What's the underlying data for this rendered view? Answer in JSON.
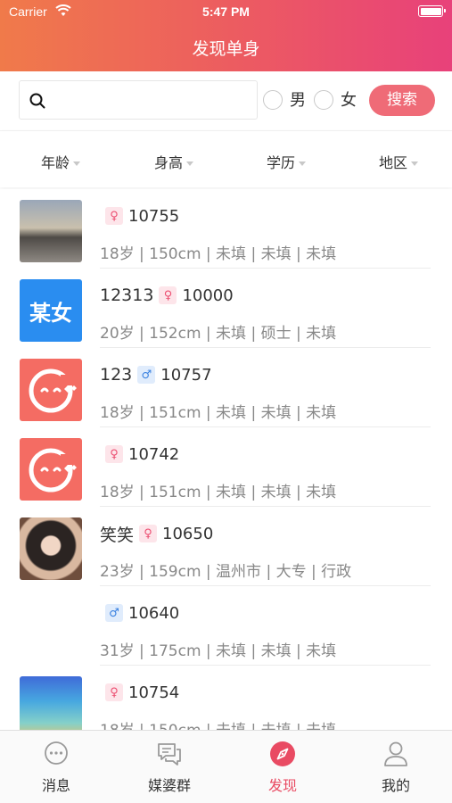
{
  "status_bar": {
    "carrier": "Carrier",
    "time": "5:47 PM"
  },
  "header": {
    "title": "发现单身"
  },
  "search": {
    "placeholder": "",
    "value": "",
    "gender_options": [
      "男",
      "女"
    ],
    "button_label": "搜索"
  },
  "filters": [
    {
      "label": "年龄"
    },
    {
      "label": "身高"
    },
    {
      "label": "学历"
    },
    {
      "label": "地区"
    }
  ],
  "users": [
    {
      "nickname": "",
      "gender": "female",
      "gender_symbol": "♀",
      "id": "10755",
      "details": "18岁 | 150cm | 未填 | 未填 | 未填",
      "avatar_type": "photo-laptop",
      "avatar_text": ""
    },
    {
      "nickname": "12313",
      "gender": "female",
      "gender_symbol": "♀",
      "id": "10000",
      "details": "20岁 | 152cm | 未填 | 硕士 | 未填",
      "avatar_type": "text",
      "avatar_text": "某女"
    },
    {
      "nickname": "123",
      "gender": "male",
      "gender_symbol": "♂",
      "id": "10757",
      "details": "18岁 | 151cm | 未填 | 未填 | 未填",
      "avatar_type": "face",
      "avatar_text": ""
    },
    {
      "nickname": "",
      "gender": "female",
      "gender_symbol": "♀",
      "id": "10742",
      "details": "18岁 | 151cm | 未填 | 未填 | 未填",
      "avatar_type": "face",
      "avatar_text": ""
    },
    {
      "nickname": "笑笑",
      "gender": "female",
      "gender_symbol": "♀",
      "id": "10650",
      "details": "23岁 | 159cm | 温州市 | 大专 | 行政",
      "avatar_type": "photo-girl",
      "avatar_text": ""
    },
    {
      "nickname": "",
      "gender": "male",
      "gender_symbol": "♂",
      "id": "10640",
      "details": "31岁 | 175cm | 未填 | 未填 | 未填",
      "avatar_type": "none",
      "avatar_text": ""
    },
    {
      "nickname": "",
      "gender": "female",
      "gender_symbol": "♀",
      "id": "10754",
      "details": "18岁 | 150cm | 未填 | 未填 | 未填",
      "avatar_type": "photo-phone",
      "avatar_text": ""
    }
  ],
  "tabs": [
    {
      "label": "消息",
      "icon": "chat-bubble-icon",
      "active": false
    },
    {
      "label": "媒婆群",
      "icon": "group-chat-icon",
      "active": false
    },
    {
      "label": "发现",
      "icon": "compass-icon",
      "active": true
    },
    {
      "label": "我的",
      "icon": "person-icon",
      "active": false
    }
  ],
  "colors": {
    "accent": "#ef6b77",
    "header_start": "#f07a4a",
    "header_end": "#e8417a",
    "female": "#ec4d70",
    "male": "#3b82e0",
    "active_tab": "#e94b63"
  }
}
